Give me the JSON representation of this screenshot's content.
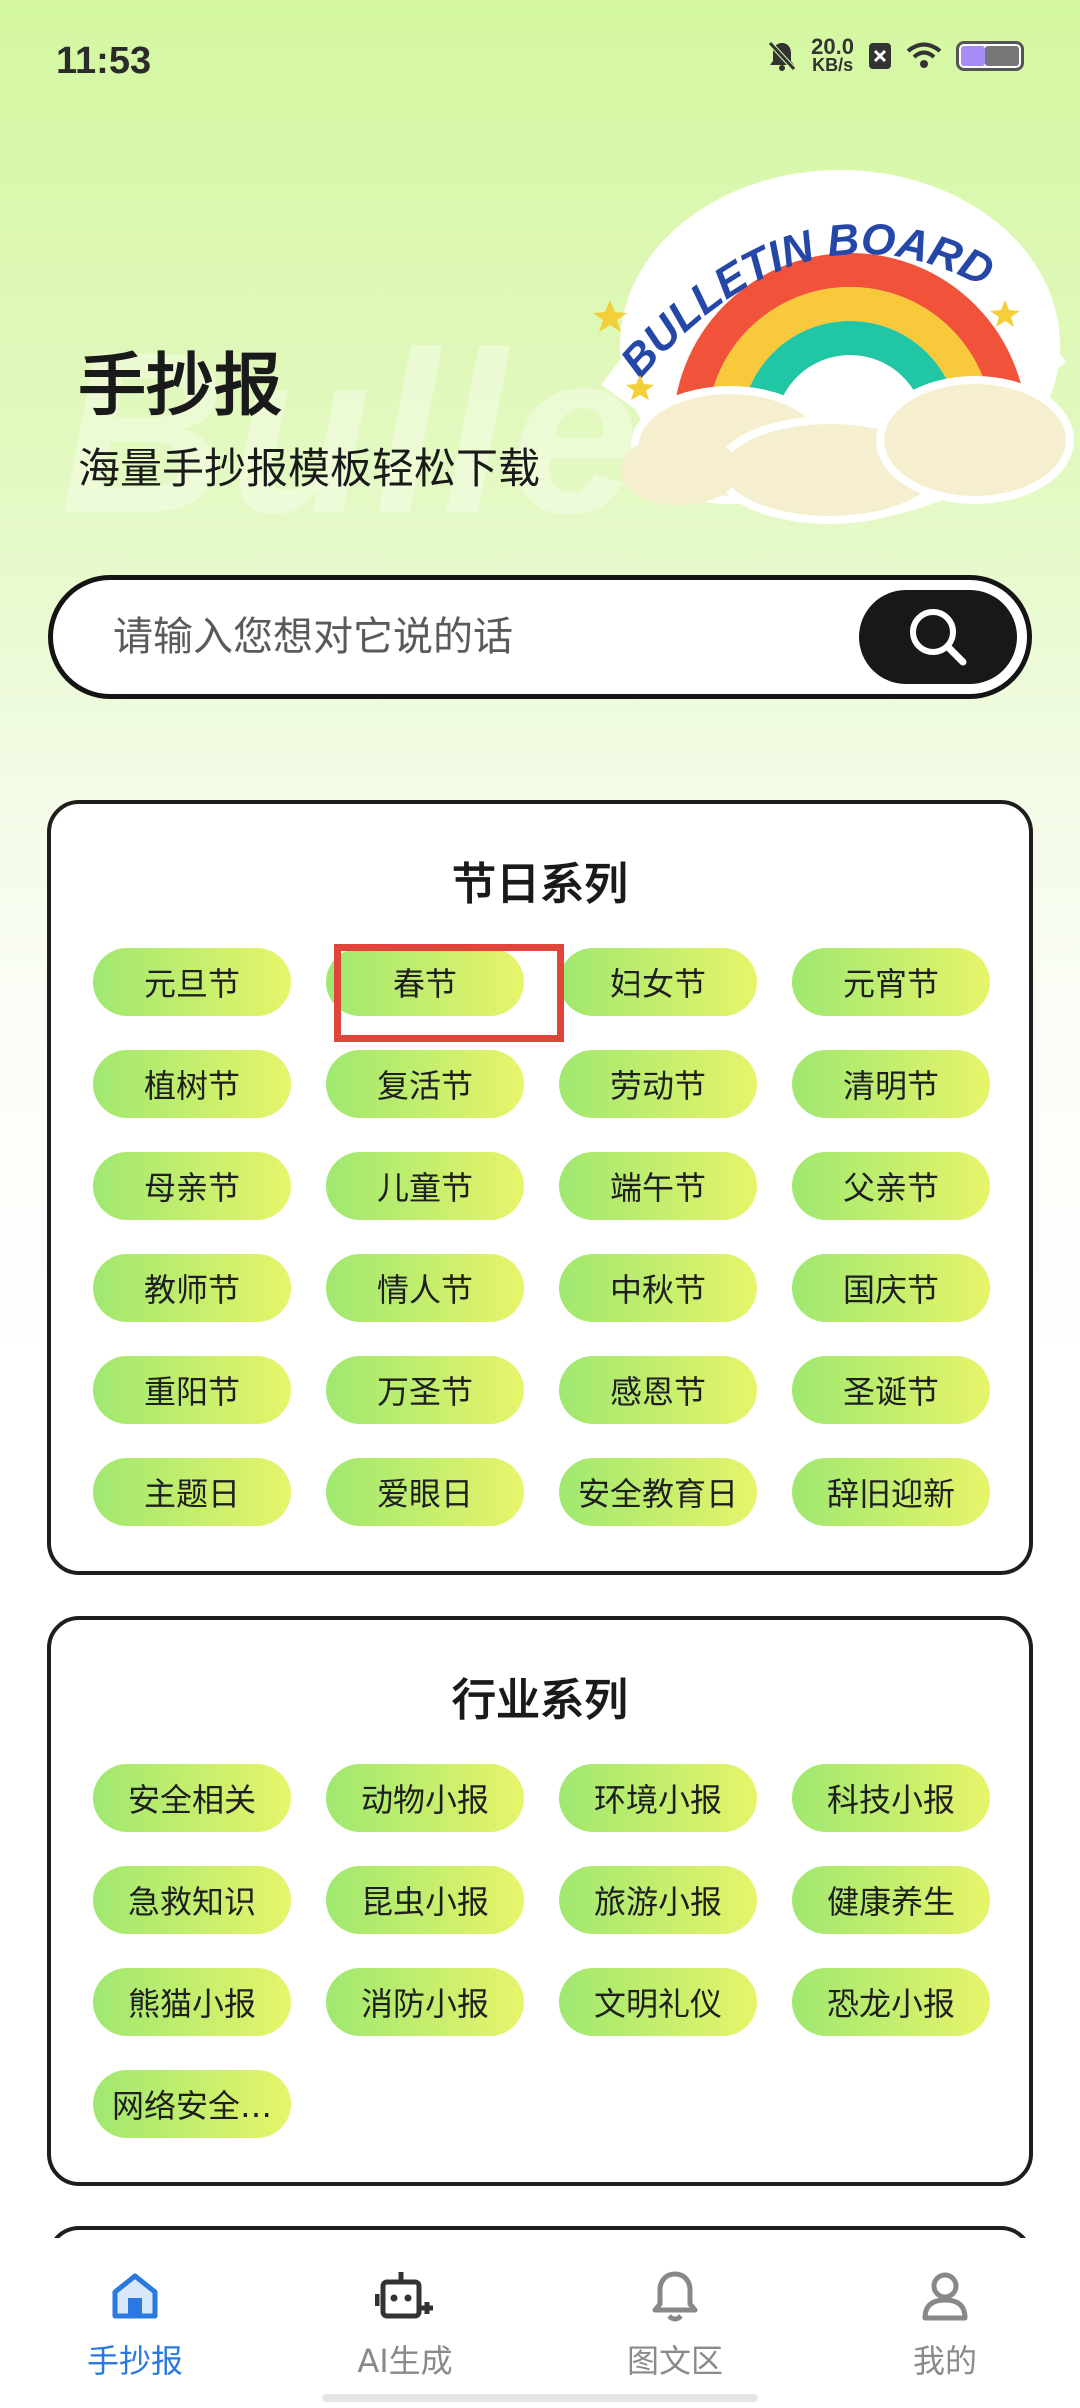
{
  "status": {
    "time": "11:53",
    "speed_value": "20.0",
    "speed_unit": "KB/s"
  },
  "hero": {
    "watermark": "Bulle",
    "title": "手抄报",
    "subtitle": "海量手抄报模板轻松下载",
    "illustration_text": "BULLETIN BOARD"
  },
  "search": {
    "placeholder": "请输入您想对它说的话"
  },
  "festival": {
    "title": "节日系列",
    "items": [
      "元旦节",
      "春节",
      "妇女节",
      "元宵节",
      "植树节",
      "复活节",
      "劳动节",
      "清明节",
      "母亲节",
      "儿童节",
      "端午节",
      "父亲节",
      "教师节",
      "情人节",
      "中秋节",
      "国庆节",
      "重阳节",
      "万圣节",
      "感恩节",
      "圣诞节",
      "主题日",
      "爱眼日",
      "安全教育日",
      "辞旧迎新"
    ]
  },
  "industry": {
    "title": "行业系列",
    "items": [
      "安全相关",
      "动物小报",
      "环境小报",
      "科技小报",
      "急救知识",
      "昆虫小报",
      "旅游小报",
      "健康养生",
      "熊猫小报",
      "消防小报",
      "文明礼仪",
      "恐龙小报",
      "网络安全…"
    ]
  },
  "nav": {
    "items": [
      {
        "label": "手抄报",
        "icon": "home-icon",
        "active": true
      },
      {
        "label": "AI生成",
        "icon": "robot-icon",
        "active": false
      },
      {
        "label": "图文区",
        "icon": "bell-icon",
        "active": false
      },
      {
        "label": "我的",
        "icon": "user-icon",
        "active": false
      }
    ]
  },
  "colors": {
    "accent": "#2a79e0",
    "highlight": "#e0453c",
    "tag_start": "#9fe870",
    "tag_end": "#e8f46a"
  }
}
